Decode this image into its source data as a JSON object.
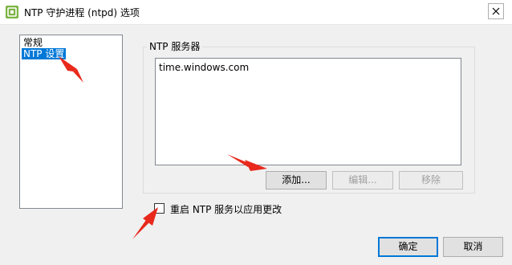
{
  "window": {
    "title": "NTP 守护进程 (ntpd) 选项",
    "app_icon": "vsphere-client-icon",
    "close_icon": "close-x-icon"
  },
  "nav": {
    "items": [
      {
        "label": "常规",
        "selected": false
      },
      {
        "label": "NTP 设置",
        "selected": true
      }
    ]
  },
  "servers": {
    "group_title": "NTP 服务器",
    "list": [
      "time.windows.com"
    ],
    "add_label": "添加...",
    "edit_label": "编辑...",
    "remove_label": "移除"
  },
  "restart": {
    "label": "重启 NTP 服务以应用更改",
    "checked": false
  },
  "footer": {
    "ok_label": "确定",
    "cancel_label": "取消"
  },
  "colors": {
    "selection": "#0078d7",
    "annotation_arrow": "#e8291c"
  }
}
